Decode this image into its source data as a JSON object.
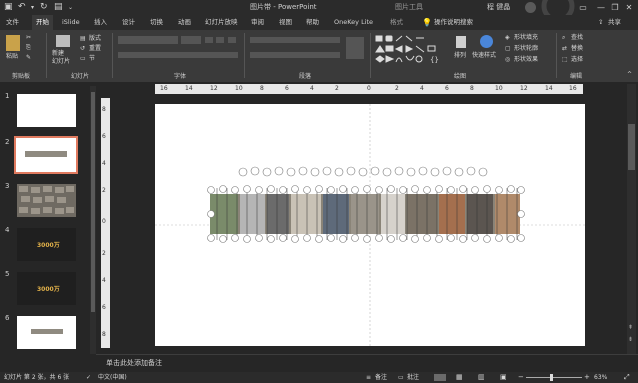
{
  "titlebar": {
    "title": "图片带 - PowerPoint",
    "context_label": "图片工具",
    "user_name": "程 健晶",
    "icons": [
      "save-icon",
      "undo-icon",
      "redo-icon",
      "present-icon",
      "customize-icon"
    ]
  },
  "tabs": [
    {
      "label": "文件"
    },
    {
      "label": "开始"
    },
    {
      "label": "iSlide"
    },
    {
      "label": "插入"
    },
    {
      "label": "设计"
    },
    {
      "label": "切换"
    },
    {
      "label": "动画"
    },
    {
      "label": "幻灯片放映"
    },
    {
      "label": "审阅"
    },
    {
      "label": "视图"
    },
    {
      "label": "帮助"
    },
    {
      "label": "OneKey Lite"
    },
    {
      "label": "格式"
    }
  ],
  "active_tab": "开始",
  "tell_me": "操作说明搜索",
  "share_label": "共享",
  "ribbon": {
    "clipboard": {
      "paste": "粘贴",
      "label": "剪贴板"
    },
    "slides": {
      "new_slide": "新建\n幻灯片",
      "layout": "版式",
      "reset": "重置",
      "section": "节",
      "label": "幻灯片"
    },
    "font": {
      "label": "字体"
    },
    "paragraph": {
      "label": "段落"
    },
    "drawing": {
      "arrange": "排列",
      "quick_styles": "快速样式",
      "shape_fill": "形状填充",
      "shape_outline": "形状轮廓",
      "shape_effects": "形状效果",
      "label": "绘图"
    },
    "editing": {
      "find": "查找",
      "replace": "替换",
      "select": "选择",
      "label": "编辑"
    }
  },
  "slide_panel": {
    "thumbnails": [
      {
        "num": "1",
        "kind": "blank"
      },
      {
        "num": "2",
        "kind": "photo-strip",
        "selected": true
      },
      {
        "num": "3",
        "kind": "photo-grid"
      },
      {
        "num": "4",
        "kind": "dark",
        "text": "3000万"
      },
      {
        "num": "5",
        "kind": "dark",
        "text": "3000万"
      },
      {
        "num": "6",
        "kind": "photo-strip"
      }
    ]
  },
  "ruler": {
    "h_ticks": [
      "16",
      "14",
      "12",
      "10",
      "8",
      "6",
      "4",
      "2",
      "0",
      "2",
      "4",
      "6",
      "8",
      "10",
      "12",
      "14",
      "16"
    ],
    "v_ticks": [
      "8",
      "6",
      "4",
      "2",
      "0",
      "2",
      "4",
      "6",
      "8"
    ]
  },
  "notes_placeholder": "单击此处添加备注",
  "status": {
    "slide_info": "幻灯片 第 2 张，共 6 张",
    "language": "中文(中国)",
    "notes": "备注",
    "comments": "批注",
    "zoom": "63%"
  }
}
